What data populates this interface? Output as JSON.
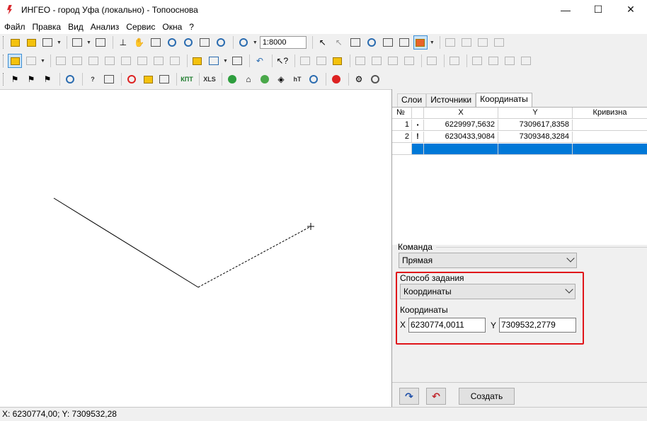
{
  "window": {
    "title": "ИНГЕО - город Уфа (локально) - Топооснова",
    "controls": {
      "minimize": "—",
      "maximize": "☐",
      "close": "✕"
    }
  },
  "menu": [
    "Файл",
    "Правка",
    "Вид",
    "Анализ",
    "Сервис",
    "Окна",
    "?"
  ],
  "toolbar": {
    "scale": "1:8000",
    "xls_label": "XLS",
    "knp_label": "КПТ"
  },
  "tabs": [
    "Слои",
    "Источники",
    "Координаты"
  ],
  "active_tab": "Координаты",
  "coords_table": {
    "headers": {
      "n": "№",
      "x": "X",
      "y": "Y",
      "k": "Кривизна"
    },
    "rows": [
      {
        "n": "1",
        "mark": "▪",
        "x": "6229997,5632",
        "y": "7309617,8358",
        "k": ""
      },
      {
        "n": "2",
        "mark": "!",
        "x": "6230433,9084",
        "y": "7309348,3284",
        "k": ""
      }
    ]
  },
  "command": {
    "label": "Команда",
    "value": "Прямая"
  },
  "method": {
    "label": "Способ задания",
    "value": "Координаты"
  },
  "coordinates": {
    "label": "Координаты",
    "x_label": "X",
    "x_value": "6230774,0011",
    "y_label": "Y",
    "y_value": "7309532,2779"
  },
  "buttons": {
    "create": "Создать"
  },
  "status": "X: 6230774,00; Y: 7309532,28",
  "colors": {
    "highlight": "#e0151a",
    "selection": "#0078d7"
  }
}
